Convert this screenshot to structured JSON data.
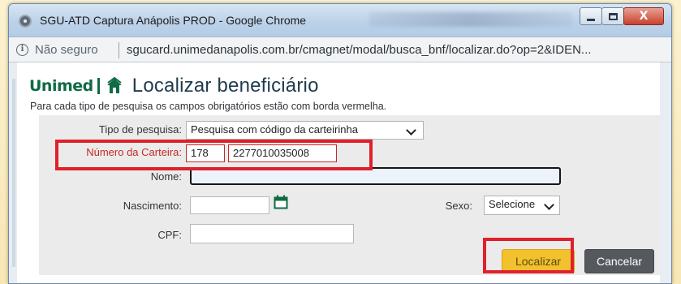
{
  "window": {
    "title": "SGU-ATD Captura Anápolis PROD - Google Chrome",
    "controls": {
      "minimize": "–",
      "maximize": "□",
      "close": "X"
    }
  },
  "addressbar": {
    "security_label": "Não seguro",
    "url": "sgucard.unimedanapolis.com.br/cmagnet/modal/busca_bnf/localizar.do?op=2&IDEN..."
  },
  "header": {
    "brand": "Unimed",
    "title": "Localizar beneficiário",
    "instructions": "Para cada tipo de pesquisa os campos obrigatórios estão com borda vermelha."
  },
  "form": {
    "tipo_pesquisa": {
      "label": "Tipo de pesquisa:",
      "value": "Pesquisa com código da carteirinha"
    },
    "numero_carteira": {
      "label": "Número da Carteira:",
      "prefix": "178",
      "number": "2277010035008"
    },
    "nome": {
      "label": "Nome:",
      "value": ""
    },
    "nascimento": {
      "label": "Nascimento:",
      "value": ""
    },
    "sexo": {
      "label": "Sexo:",
      "value": "Selecione"
    },
    "cpf": {
      "label": "CPF:",
      "value": ""
    }
  },
  "actions": {
    "localizar": "Localizar",
    "cancelar": "Cancelar"
  },
  "colors": {
    "brand_green": "#0f6b43",
    "required_red": "#c62828",
    "highlight_red": "#e0202a",
    "primary_button": "#f2c12e",
    "secondary_button": "#55595e"
  }
}
